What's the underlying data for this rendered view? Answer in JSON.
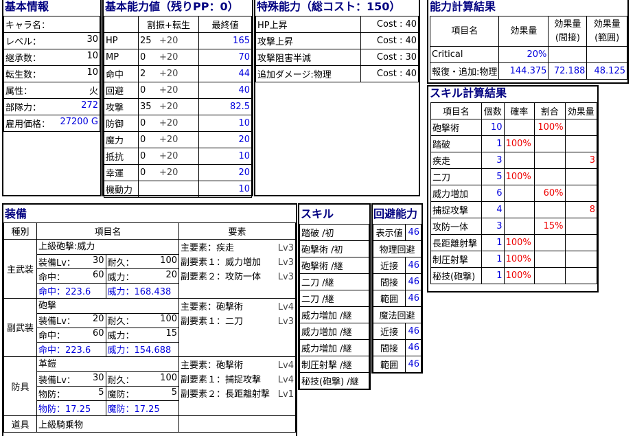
{
  "basic": {
    "title": "基本情報",
    "rows": [
      {
        "label": "キャラ名：",
        "value": ""
      },
      {
        "label": "レベル：",
        "value": "30"
      },
      {
        "label": "継承数：",
        "value": "10"
      },
      {
        "label": "転生数：",
        "value": "10"
      },
      {
        "label": "属性：",
        "value": "火"
      },
      {
        "label": "部隊力：",
        "value": "272"
      },
      {
        "label": "雇用価格：",
        "value": "27200 G"
      }
    ]
  },
  "stats": {
    "title": "基本能力値（残りPP：0）",
    "headers": [
      "割振+転生",
      "最終値"
    ],
    "rows": [
      {
        "name": "HP",
        "alloc": "25",
        "bonus": "+20",
        "final": "165"
      },
      {
        "name": "MP",
        "alloc": "0",
        "bonus": "+20",
        "final": "70"
      },
      {
        "name": "命中",
        "alloc": "2",
        "bonus": "+20",
        "final": "44"
      },
      {
        "name": "回避",
        "alloc": "0",
        "bonus": "+20",
        "final": "40"
      },
      {
        "name": "攻撃",
        "alloc": "35",
        "bonus": "+20",
        "final": "82.5"
      },
      {
        "name": "防御",
        "alloc": "0",
        "bonus": "+20",
        "final": "10"
      },
      {
        "name": "魔力",
        "alloc": "0",
        "bonus": "+20",
        "final": "20"
      },
      {
        "name": "抵抗",
        "alloc": "0",
        "bonus": "+20",
        "final": "10"
      },
      {
        "name": "幸運",
        "alloc": "0",
        "bonus": "+20",
        "final": "20"
      },
      {
        "name": "機動力",
        "alloc": "",
        "bonus": "",
        "final": "10"
      }
    ]
  },
  "special": {
    "title": "特殊能力（総コスト：150）",
    "rows": [
      {
        "name": "HP上昇",
        "cost": "Cost : 40"
      },
      {
        "name": "攻撃上昇",
        "cost": "Cost : 40"
      },
      {
        "name": "攻撃阻害半減",
        "cost": "Cost : 30"
      },
      {
        "name": "追加ダメージ:物理",
        "cost": "Cost : 40"
      }
    ]
  },
  "calc": {
    "title": "能力計算結果",
    "headers": [
      "項目名",
      "効果量",
      "効果量\n(間接)",
      "効果量\n(範囲)"
    ],
    "rows": [
      {
        "name": "Critical",
        "v1": "20%",
        "v2": "",
        "v3": ""
      },
      {
        "name": "報復・追加:物理",
        "v1": "144.375",
        "v2": "72.188",
        "v3": "48.125"
      }
    ]
  },
  "skillcalc": {
    "title": "スキル計算結果",
    "headers": [
      "項目名",
      "個数",
      "確率",
      "割合",
      "効果量"
    ],
    "rows": [
      {
        "name": "砲撃術",
        "count": "10",
        "rate": "",
        "ratio": "100%",
        "effect": ""
      },
      {
        "name": "踏破",
        "count": "1",
        "rate": "100%",
        "ratio": "",
        "effect": ""
      },
      {
        "name": "疾走",
        "count": "3",
        "rate": "",
        "ratio": "",
        "effect": "3"
      },
      {
        "name": "二刀",
        "count": "5",
        "rate": "100%",
        "ratio": "",
        "effect": ""
      },
      {
        "name": "威力増加",
        "count": "6",
        "rate": "",
        "ratio": "60%",
        "effect": ""
      },
      {
        "name": "捕捉攻撃",
        "count": "4",
        "rate": "",
        "ratio": "",
        "effect": "8"
      },
      {
        "name": "攻防一体",
        "count": "3",
        "rate": "",
        "ratio": "15%",
        "effect": ""
      },
      {
        "name": "長距離射撃",
        "count": "1",
        "rate": "100%",
        "ratio": "",
        "effect": ""
      },
      {
        "name": "制圧射撃",
        "count": "1",
        "rate": "100%",
        "ratio": "",
        "effect": ""
      },
      {
        "name": "秘技(砲撃)",
        "count": "1",
        "rate": "100%",
        "ratio": "",
        "effect": ""
      }
    ]
  },
  "equip": {
    "title": "装備",
    "headers": [
      "種別",
      "項目名",
      "要素"
    ],
    "items": [
      {
        "type": "主武装",
        "name": "上級砲撃:威力",
        "l1": "装備Lv：",
        "v1": "30",
        "l2": "耐久：",
        "v2": "100",
        "l3": "命中：",
        "v3": "60",
        "l4": "威力：",
        "v4": "20",
        "b1": "命中：223.6",
        "b2": "威力：168.438",
        "elements": [
          {
            "label": "主要素：疾走",
            "lv": "Lv3"
          },
          {
            "label": "副要素１：威力増加",
            "lv": "Lv3"
          },
          {
            "label": "副要素２：攻防一体",
            "lv": "Lv3"
          }
        ]
      },
      {
        "type": "副武装",
        "name": "砲撃",
        "l1": "装備Lv：",
        "v1": "20",
        "l2": "耐久：",
        "v2": "100",
        "l3": "命中：",
        "v3": "60",
        "l4": "威力：",
        "v4": "15",
        "b1": "命中：223.6",
        "b2": "威力：154.688",
        "elements": [
          {
            "label": "主要素：砲撃術",
            "lv": "Lv4"
          },
          {
            "label": "副要素１：二刀",
            "lv": "Lv3"
          }
        ]
      },
      {
        "type": "防具",
        "name": "革鎧",
        "l1": "装備Lv：",
        "v1": "30",
        "l2": "耐久：",
        "v2": "100",
        "l3": "物防：",
        "v3": "5",
        "l4": "魔防：",
        "v4": "5",
        "b1": "物防：17.25",
        "b2": "魔防：17.25",
        "elements": [
          {
            "label": "主要素：砲撃術",
            "lv": "Lv4"
          },
          {
            "label": "副要素１：捕捉攻撃",
            "lv": "Lv4"
          },
          {
            "label": "副要素２：長距離射撃",
            "lv": "Lv1"
          }
        ]
      }
    ],
    "tool": {
      "type": "道具",
      "name": "上級騎乗物"
    }
  },
  "skills": {
    "title": "スキル",
    "items": [
      "踏破 /初",
      "砲撃術 /初",
      "砲撃術 /継",
      "二刀 /継",
      "二刀 /継",
      "威力増加 /継",
      "威力増加 /継",
      "威力増加 /継",
      "制圧射撃 /継",
      "秘技(砲撃) /継"
    ]
  },
  "evasion": {
    "title": "回避能力",
    "rows": [
      {
        "label": "表示値",
        "value": "46"
      },
      {
        "label": "物理回避",
        "value": ""
      },
      {
        "label": "近接",
        "value": "46"
      },
      {
        "label": "間接",
        "value": "46"
      },
      {
        "label": "範囲",
        "value": "46"
      },
      {
        "label": "魔法回避",
        "value": ""
      },
      {
        "label": "近接",
        "value": "46"
      },
      {
        "label": "間接",
        "value": "46"
      },
      {
        "label": "範囲",
        "value": "46"
      }
    ]
  }
}
